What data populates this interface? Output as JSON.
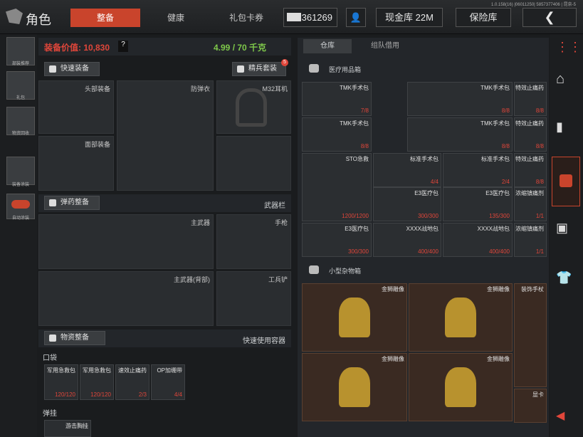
{
  "topbar": {
    "title": "角色",
    "tabs": [
      "整备",
      "健康",
      "礼包卡券"
    ],
    "money": "361269",
    "cash_vault": "现金库 22M",
    "safe_box": "保险库",
    "version": "1.0.158(16) |06011250| 5857377406 | 昆奈-5"
  },
  "leftnav": [
    "部装推荐",
    "礼包",
    "物资回收",
    "装备涂装",
    "自动涂装"
  ],
  "equip": {
    "value_label": "装备价值: 10,830",
    "help": "?",
    "weight": "4.99 / 70 千克",
    "quick_equip": "快速装备",
    "elite_set": "精兵套装",
    "elite_badge": "5",
    "slots": {
      "head": "头部装备",
      "vest": "防弹衣",
      "ear": "M32耳机",
      "face": "面部装备",
      "primary": "主武器",
      "pistol": "手枪",
      "primary_back": "主武器(背部)",
      "tool": "工兵铲"
    },
    "ammo_btn": "弹药整备",
    "weapon_bar": "武器栏",
    "supply_btn": "物资整备",
    "quick_container": "快速使用容器",
    "pocket": "口袋",
    "belt": "弹挂",
    "pocket_items": [
      {
        "name": "军用急救包",
        "count": "120/120"
      },
      {
        "name": "军用急救包",
        "count": "120/120"
      },
      {
        "name": "速效止痛药",
        "count": "2/3"
      },
      {
        "name": "OP加绷带",
        "count": "4/4"
      }
    ],
    "belt_item": "游击胸挂"
  },
  "storage": {
    "tabs": [
      "仓库",
      "组队借用"
    ],
    "medical": "医疗用品箱",
    "misc": "小型杂物箱",
    "med_items": [
      {
        "name": "TMK手术包",
        "count": "7/8"
      },
      {
        "name": "TMK手术包",
        "count": "8/8"
      },
      {
        "name": "特效止痛药",
        "count": "8/8"
      },
      {
        "name": "TMK手术包",
        "count": "8/8"
      },
      {
        "name": "TMK手术包",
        "count": "8/8"
      },
      {
        "name": "特效止痛药",
        "count": "8/8"
      },
      {
        "name": "STO急救",
        "count": "1200/1200"
      },
      {
        "name": "标准手术包",
        "count": "4/4"
      },
      {
        "name": "标准手术包",
        "count": "2/4"
      },
      {
        "name": "特效止痛药",
        "count": "8/8"
      },
      {
        "name": "E3医疗包",
        "count": "300/300"
      },
      {
        "name": "E3医疗包",
        "count": "135/300"
      },
      {
        "name": "浓缩镇痛剂",
        "count": "1/1"
      },
      {
        "name": "E3医疗包",
        "count": "300/300"
      },
      {
        "name": "XXXX战地包",
        "count": "400/400"
      },
      {
        "name": "XXXX战地包",
        "count": "400/400"
      },
      {
        "name": "浓缩镇痛剂",
        "count": "1/1"
      }
    ],
    "misc_items": [
      "金狮雕像",
      "金狮雕像",
      "装饰手杖",
      "金狮雕像",
      "金狮雕像",
      "显卡"
    ]
  }
}
